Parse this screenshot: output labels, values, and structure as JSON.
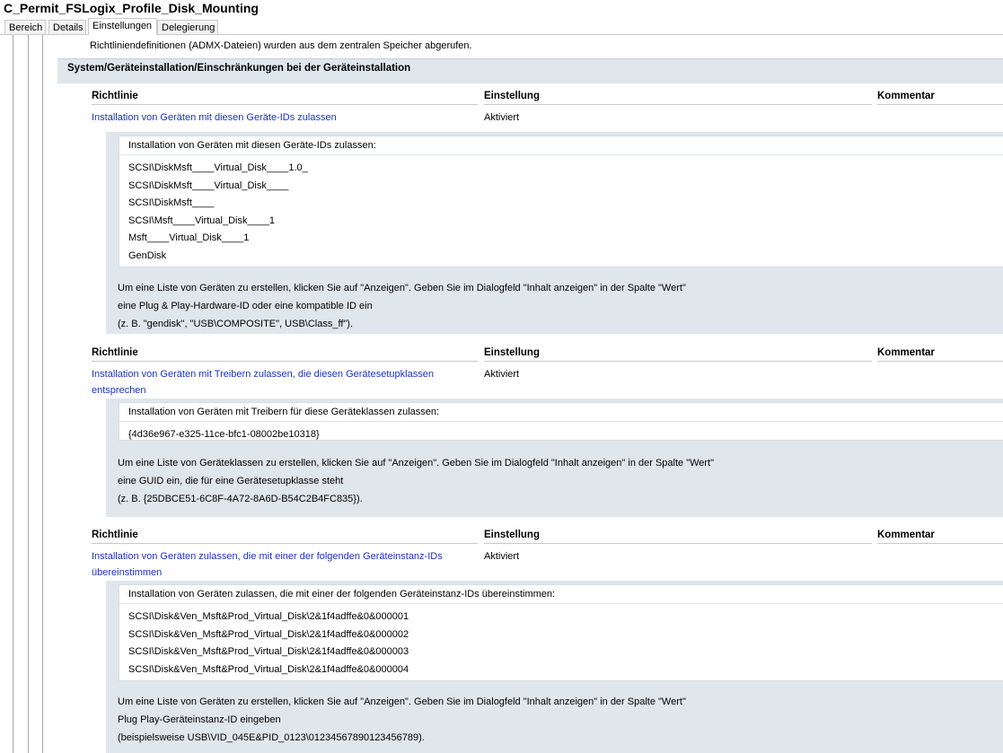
{
  "window": {
    "title": "C_Permit_FSLogix_Profile_Disk_Mounting"
  },
  "tabs": [
    {
      "label": "Bereich"
    },
    {
      "label": "Details"
    },
    {
      "label": "Einstellungen"
    },
    {
      "label": "Delegierung"
    }
  ],
  "intro_text": "Richtliniendefinitionen (ADMX-Dateien) wurden aus dem zentralen Speicher abgerufen.",
  "section": {
    "title": "System/Geräteinstallation/Einschränkungen bei der Geräteinstallation"
  },
  "columns": {
    "policy": "Richtlinie",
    "setting": "Einstellung",
    "comment": "Kommentar"
  },
  "policies": [
    {
      "name_lines": [
        "Installation von Geräten mit diesen Geräte-IDs zulassen"
      ],
      "setting": "Aktiviert",
      "list_header": "Installation von Geräten mit diesen Geräte-IDs zulassen:",
      "items": [
        "SCSI\\DiskMsft____Virtual_Disk____1.0_",
        "SCSI\\DiskMsft____Virtual_Disk____",
        "SCSI\\DiskMsft____",
        "SCSI\\Msft____Virtual_Disk____1",
        "Msft____Virtual_Disk____1",
        "GenDisk"
      ],
      "notes": [
        "Um eine Liste von Geräten zu erstellen, klicken Sie auf \"Anzeigen\". Geben Sie im Dialogfeld \"Inhalt anzeigen\" in der Spalte \"Wert\"",
        "eine Plug & Play-Hardware-ID oder eine kompatible ID ein",
        "(z. B. \"gendisk\", \"USB\\COMPOSITE\", USB\\Class_ff\")."
      ]
    },
    {
      "name_lines": [
        "Installation von Geräten mit Treibern zulassen, die diesen Gerätesetupklassen",
        "entsprechen"
      ],
      "setting": "Aktiviert",
      "list_header": "Installation von Geräten mit Treibern für diese Geräteklassen zulassen:",
      "items": [
        "{4d36e967-e325-11ce-bfc1-08002be10318}"
      ],
      "notes": [
        "Um eine Liste von Geräteklassen zu erstellen, klicken Sie auf \"Anzeigen\". Geben Sie im Dialogfeld \"Inhalt anzeigen\" in der Spalte \"Wert\"",
        "eine GUID ein, die für eine Gerätesetupklasse steht",
        "(z. B. {25DBCE51-6C8F-4A72-8A6D-B54C2B4FC835})."
      ]
    },
    {
      "name_lines": [
        "Installation von Geräten zulassen, die mit einer der folgenden Geräteinstanz-IDs",
        "übereinstimmen"
      ],
      "setting": "Aktiviert",
      "list_header": "Installation von Geräten zulassen, die mit einer der folgenden Geräteinstanz-IDs übereinstimmen:",
      "items": [
        "SCSI\\Disk&Ven_Msft&Prod_Virtual_Disk\\2&1f4adffe&0&000001",
        "SCSI\\Disk&Ven_Msft&Prod_Virtual_Disk\\2&1f4adffe&0&000002",
        "SCSI\\Disk&Ven_Msft&Prod_Virtual_Disk\\2&1f4adffe&0&000003",
        "SCSI\\Disk&Ven_Msft&Prod_Virtual_Disk\\2&1f4adffe&0&000004"
      ],
      "notes": [
        "Um eine Liste von Geräten zu erstellen, klicken Sie auf \"Anzeigen\". Geben Sie im Dialogfeld \"Inhalt anzeigen\" in der Spalte \"Wert\"",
        "Plug Play-Geräteinstanz-ID eingeben",
        "(beispielsweise USB\\VID_045E&PID_0123\\01234567890123456789)."
      ]
    }
  ]
}
